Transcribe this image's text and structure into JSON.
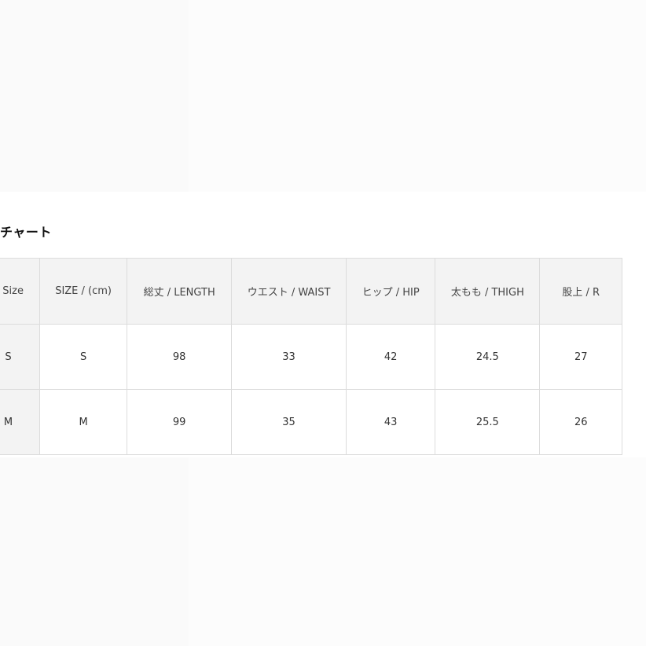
{
  "section": {
    "title": "チャート"
  },
  "size_table": {
    "headers": [
      "n Size",
      "SIZE / (cm)",
      "総丈 / LENGTH",
      "ウエスト / WAIST",
      "ヒップ / HIP",
      "太もも / THIGH",
      "股上 / R"
    ],
    "rows": [
      [
        "S",
        "S",
        "98",
        "33",
        "42",
        "24.5",
        "27"
      ],
      [
        "M",
        "M",
        "99",
        "35",
        "43",
        "25.5",
        "26"
      ]
    ]
  },
  "colors": {
    "header_bg": "#f3f3f3",
    "border": "#dcdcdc",
    "panel_bg": "#ffffff",
    "page_bg": "#fafafa"
  }
}
